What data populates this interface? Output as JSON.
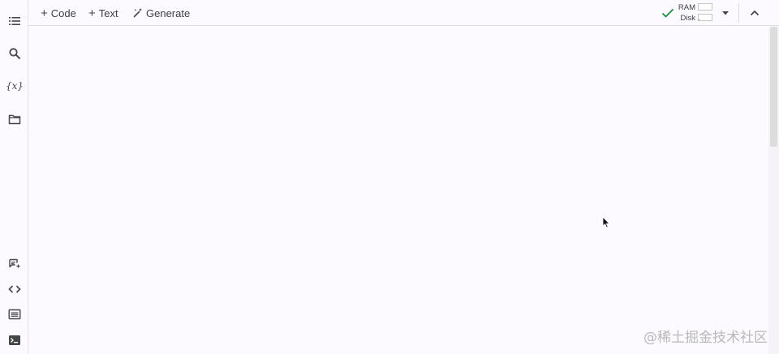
{
  "sidebar": {
    "top_icons": [
      "table-of-contents-icon",
      "search-icon",
      "variables-icon",
      "files-icon"
    ],
    "bottom_icons": [
      "notes-icon",
      "code-snippets-icon",
      "command-palette-icon",
      "terminal-icon"
    ],
    "variables_glyph": "{x}"
  },
  "toolbar": {
    "add_code_label": "Code",
    "add_text_label": "Text",
    "generate_label": "Generate",
    "add_glyph": "+",
    "resources": {
      "ram_label": "RAM",
      "disk_label": "Disk",
      "status": "connected",
      "ram_usage_fraction": 0.0,
      "disk_usage_fraction": 0.05
    }
  },
  "watermark": "@稀土掘金技术社区",
  "colors": {
    "background": "#fcfaff",
    "check": "#1e8e3e",
    "icon": "#444746"
  }
}
